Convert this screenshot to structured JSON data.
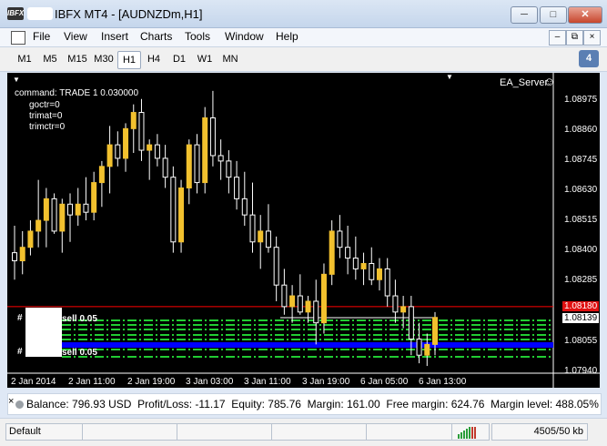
{
  "window": {
    "title": "IBFX MT4 - [AUDNZDm,H1]",
    "app_icon": "IBFX",
    "controls": {
      "minimize": "─",
      "maximize": "□",
      "close": "✕"
    }
  },
  "menu": {
    "items": [
      "File",
      "View",
      "Insert",
      "Charts",
      "Tools",
      "Window",
      "Help"
    ],
    "mdi_controls": {
      "minimize": "–",
      "restore": "⧉",
      "close": "×"
    }
  },
  "timeframes": {
    "items": [
      "M1",
      "M5",
      "M15",
      "M30",
      "H1",
      "H4",
      "D1",
      "W1",
      "MN"
    ],
    "active": "H1",
    "notification_count": "4"
  },
  "chart": {
    "symbol_header": "EA_Server",
    "overlay_lines": [
      "command: TRADE 1 0.030000",
      "goctr=0",
      "trimat=0",
      "trimctr=0"
    ],
    "order_labels": [
      "sell 0.05",
      "sell 0.05"
    ],
    "order_prefix": "#",
    "price_axis": [
      "1.08975",
      "1.08860",
      "1.08745",
      "1.08630",
      "1.08515",
      "1.08400",
      "1.08285",
      "1.08180",
      "1.08139",
      "1.08055",
      "1.07940"
    ],
    "price_highlight": "1.08180",
    "bid_label": "1.08139",
    "time_axis": [
      "2 Jan 2014",
      "2 Jan 11:00",
      "2 Jan 19:00",
      "3 Jan 03:00",
      "3 Jan 11:00",
      "3 Jan 19:00",
      "6 Jan 05:00",
      "6 Jan 13:00"
    ],
    "colors": {
      "background": "#000000",
      "bull": "#f2c12e",
      "bear": "#ffffff",
      "order_lines": "#22cc33",
      "selected_order": "#0000ff",
      "price_line": "#ff0000"
    }
  },
  "chart_data": {
    "type": "candlestick",
    "symbol": "AUDNZDm",
    "timeframe": "H1",
    "ylim": [
      1.0794,
      1.0902
    ],
    "candles": [
      {
        "o": 1.0838,
        "h": 1.0848,
        "l": 1.0828,
        "c": 1.0835
      },
      {
        "o": 1.0835,
        "h": 1.0846,
        "l": 1.083,
        "c": 1.084
      },
      {
        "o": 1.084,
        "h": 1.085,
        "l": 1.0837,
        "c": 1.0846
      },
      {
        "o": 1.0846,
        "h": 1.0865,
        "l": 1.084,
        "c": 1.085
      },
      {
        "o": 1.085,
        "h": 1.0862,
        "l": 1.084,
        "c": 1.0858
      },
      {
        "o": 1.0858,
        "h": 1.086,
        "l": 1.0845,
        "c": 1.0846
      },
      {
        "o": 1.0846,
        "h": 1.0858,
        "l": 1.0838,
        "c": 1.0856
      },
      {
        "o": 1.0856,
        "h": 1.086,
        "l": 1.0842,
        "c": 1.0852
      },
      {
        "o": 1.0852,
        "h": 1.0862,
        "l": 1.0848,
        "c": 1.0856
      },
      {
        "o": 1.0856,
        "h": 1.0866,
        "l": 1.085,
        "c": 1.0853
      },
      {
        "o": 1.0853,
        "h": 1.0868,
        "l": 1.085,
        "c": 1.0864
      },
      {
        "o": 1.0864,
        "h": 1.0872,
        "l": 1.0855,
        "c": 1.087
      },
      {
        "o": 1.087,
        "h": 1.0885,
        "l": 1.086,
        "c": 1.0878
      },
      {
        "o": 1.0878,
        "h": 1.0883,
        "l": 1.087,
        "c": 1.0873
      },
      {
        "o": 1.0873,
        "h": 1.0886,
        "l": 1.0868,
        "c": 1.0884
      },
      {
        "o": 1.0884,
        "h": 1.0893,
        "l": 1.0875,
        "c": 1.089
      },
      {
        "o": 1.089,
        "h": 1.0895,
        "l": 1.0872,
        "c": 1.0876
      },
      {
        "o": 1.0876,
        "h": 1.088,
        "l": 1.0865,
        "c": 1.0878
      },
      {
        "o": 1.0878,
        "h": 1.0882,
        "l": 1.087,
        "c": 1.0873
      },
      {
        "o": 1.0873,
        "h": 1.0878,
        "l": 1.0862,
        "c": 1.0866
      },
      {
        "o": 1.0866,
        "h": 1.087,
        "l": 1.0838,
        "c": 1.0842
      },
      {
        "o": 1.0842,
        "h": 1.0865,
        "l": 1.0838,
        "c": 1.0862
      },
      {
        "o": 1.0862,
        "h": 1.088,
        "l": 1.0856,
        "c": 1.0878
      },
      {
        "o": 1.0878,
        "h": 1.0882,
        "l": 1.086,
        "c": 1.0864
      },
      {
        "o": 1.0864,
        "h": 1.0892,
        "l": 1.086,
        "c": 1.0888
      },
      {
        "o": 1.0888,
        "h": 1.0898,
        "l": 1.087,
        "c": 1.0874
      },
      {
        "o": 1.0874,
        "h": 1.088,
        "l": 1.0865,
        "c": 1.0872
      },
      {
        "o": 1.0872,
        "h": 1.0876,
        "l": 1.086,
        "c": 1.0866
      },
      {
        "o": 1.0866,
        "h": 1.0872,
        "l": 1.0854,
        "c": 1.0858
      },
      {
        "o": 1.0858,
        "h": 1.0868,
        "l": 1.0848,
        "c": 1.0852
      },
      {
        "o": 1.0852,
        "h": 1.0864,
        "l": 1.0838,
        "c": 1.0842
      },
      {
        "o": 1.0842,
        "h": 1.0852,
        "l": 1.0832,
        "c": 1.0846
      },
      {
        "o": 1.0846,
        "h": 1.0856,
        "l": 1.0838,
        "c": 1.084
      },
      {
        "o": 1.084,
        "h": 1.0844,
        "l": 1.082,
        "c": 1.0826
      },
      {
        "o": 1.0826,
        "h": 1.0832,
        "l": 1.0815,
        "c": 1.0818
      },
      {
        "o": 1.0818,
        "h": 1.0826,
        "l": 1.0812,
        "c": 1.0822
      },
      {
        "o": 1.0822,
        "h": 1.083,
        "l": 1.0815,
        "c": 1.0816
      },
      {
        "o": 1.0816,
        "h": 1.0822,
        "l": 1.0812,
        "c": 1.082
      },
      {
        "o": 1.082,
        "h": 1.0828,
        "l": 1.0804,
        "c": 1.0812
      },
      {
        "o": 1.0812,
        "h": 1.0834,
        "l": 1.0808,
        "c": 1.083
      },
      {
        "o": 1.083,
        "h": 1.085,
        "l": 1.0826,
        "c": 1.0846
      },
      {
        "o": 1.0846,
        "h": 1.0852,
        "l": 1.0836,
        "c": 1.084
      },
      {
        "o": 1.084,
        "h": 1.0848,
        "l": 1.083,
        "c": 1.0836
      },
      {
        "o": 1.0836,
        "h": 1.0844,
        "l": 1.0828,
        "c": 1.0832
      },
      {
        "o": 1.0832,
        "h": 1.0838,
        "l": 1.0826,
        "c": 1.0834
      },
      {
        "o": 1.0834,
        "h": 1.084,
        "l": 1.0826,
        "c": 1.0828
      },
      {
        "o": 1.0828,
        "h": 1.0836,
        "l": 1.0824,
        "c": 1.0832
      },
      {
        "o": 1.0832,
        "h": 1.0836,
        "l": 1.0818,
        "c": 1.0822
      },
      {
        "o": 1.0822,
        "h": 1.0828,
        "l": 1.0812,
        "c": 1.0816
      },
      {
        "o": 1.0816,
        "h": 1.0822,
        "l": 1.081,
        "c": 1.0818
      },
      {
        "o": 1.0818,
        "h": 1.0822,
        "l": 1.08,
        "c": 1.0806
      },
      {
        "o": 1.0806,
        "h": 1.0812,
        "l": 1.0797,
        "c": 1.08
      },
      {
        "o": 1.08,
        "h": 1.0808,
        "l": 1.0796,
        "c": 1.0804
      },
      {
        "o": 1.0804,
        "h": 1.0816,
        "l": 1.08,
        "c": 1.0814
      }
    ],
    "horizontal_lines": [
      1.0818,
      1.08139
    ]
  },
  "account": {
    "balance": "Balance: 796.93 USD",
    "profit_loss": "Profit/Loss: -11.17",
    "equity": "Equity: 785.76",
    "margin": "Margin: 161.00",
    "free_margin": "Free margin: 624.76",
    "margin_level": "Margin level: 488.05%"
  },
  "statusbar": {
    "profile": "Default",
    "traffic": "4505/50 kb"
  }
}
